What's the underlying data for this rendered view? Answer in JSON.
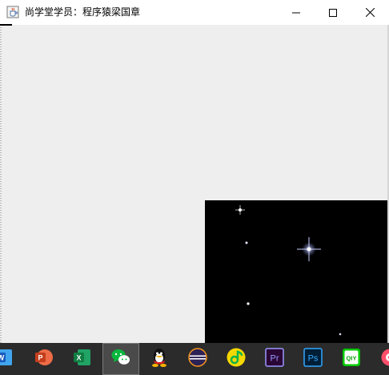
{
  "window": {
    "title": "尚学堂学员：程序猿梁国章",
    "app_icon": "java-cup-icon",
    "controls": [
      "minimize-icon",
      "maximize-icon",
      "close-icon"
    ]
  },
  "content": {
    "background_color": "#eeeeee",
    "starfield_background": "#000000",
    "star_color": "#ffffff"
  },
  "taskbar": {
    "background_color": "#2b2b2b",
    "apps": [
      {
        "name": "word-icon",
        "letter": "W",
        "color": "#185abd"
      },
      {
        "name": "powerpoint-icon",
        "letter": "P",
        "color": "#c43e1c"
      },
      {
        "name": "excel-icon",
        "letter": "X",
        "color": "#107c41"
      },
      {
        "name": "wechat-icon",
        "active": true,
        "color": "#09b83e"
      },
      {
        "name": "qq-icon"
      },
      {
        "name": "eclipse-icon",
        "color": "#2c2255"
      },
      {
        "name": "qq-music-icon",
        "color": "#f5d800"
      },
      {
        "name": "premiere-pro-icon",
        "letter": "Pr",
        "color": "#9999ff"
      },
      {
        "name": "photoshop-icon",
        "letter": "Ps",
        "color": "#31a8ff"
      },
      {
        "name": "iqiyi-icon",
        "letter": "QIY",
        "color": "#00c800"
      },
      {
        "name": "media-player-icon",
        "color": "#ff4f6a"
      }
    ]
  }
}
